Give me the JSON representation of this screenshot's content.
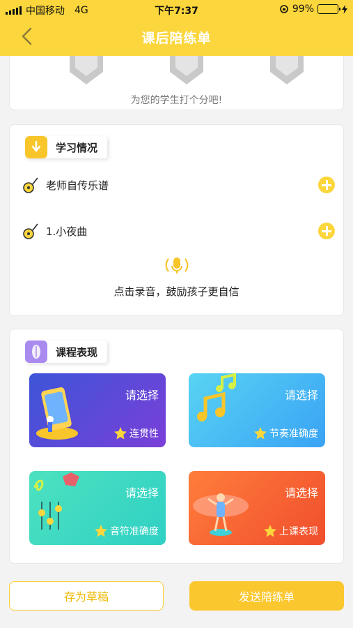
{
  "status_bar": {
    "carrier": "中国移动",
    "network": "4G",
    "time": "下午7:37",
    "battery": "99%",
    "battery_level": 0.99
  },
  "nav": {
    "title": "课后陪练单",
    "back_icon": "chevron-left-icon"
  },
  "rating": {
    "hint": "为您的学生打个分吧!",
    "medal_icon": "medal-icon"
  },
  "study": {
    "title": "学习情况",
    "songs": [
      {
        "name": "老师自传乐谱"
      },
      {
        "name": "1.小夜曲"
      }
    ],
    "record_hint": "点击录音，鼓励孩子更自信"
  },
  "performance": {
    "title": "课程表现",
    "cards": [
      {
        "choose": "请选择",
        "metric": "连贯性"
      },
      {
        "choose": "请选择",
        "metric": "节奏准确度"
      },
      {
        "choose": "请选择",
        "metric": "音符准确度"
      },
      {
        "choose": "请选择",
        "metric": "上课表现"
      }
    ]
  },
  "actions": {
    "draft": "存为草稿",
    "send": "发送陪练单"
  },
  "colors": {
    "brand_yellow": "#fbd63c",
    "button_yellow": "#fbc72e"
  }
}
